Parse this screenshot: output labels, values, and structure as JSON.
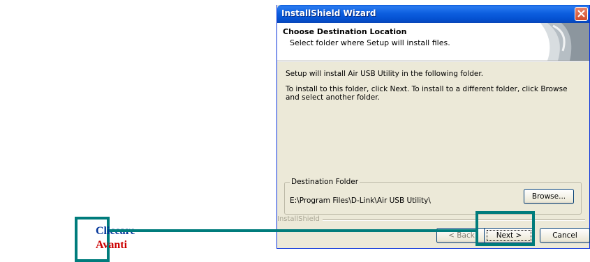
{
  "window": {
    "title": "InstallShield Wizard",
    "close_icon": "close-icon"
  },
  "header": {
    "title": "Choose Destination Location",
    "subtitle": "Select folder where Setup will install files."
  },
  "body": {
    "line1": "Setup will install Air USB Utility in the following folder.",
    "line2": "To install to this folder, click Next. To install to a different folder, click Browse and select another folder."
  },
  "destination": {
    "legend": "Destination Folder",
    "path": "E:\\Program Files\\D-Link\\Air USB Utility\\",
    "browse_label": "Browse..."
  },
  "footer": {
    "brand": "InstallShield",
    "back_label": "< Back",
    "next_label": "Next >",
    "cancel_label": "Cancel"
  },
  "annotation": {
    "line1": "Cliccare",
    "line2": "Avanti",
    "accent": "#007c7c",
    "line1_color": "#003399",
    "line2_color": "#cc0000"
  }
}
